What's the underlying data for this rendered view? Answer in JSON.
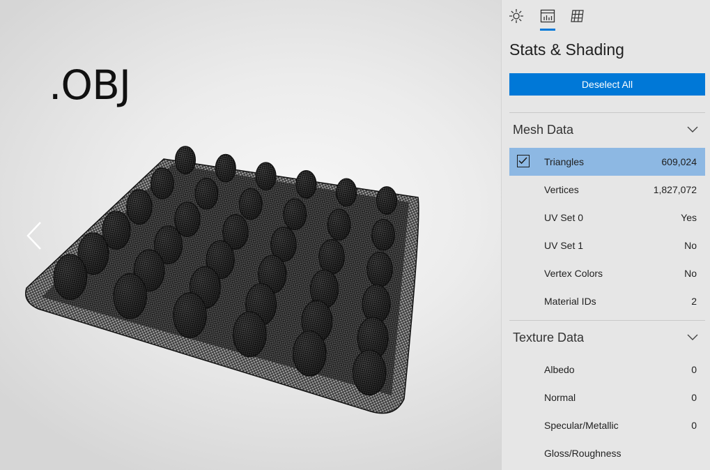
{
  "viewport": {
    "file_label": ".OBJ"
  },
  "panel": {
    "tabs": [
      "sun-icon",
      "stats-chart-icon",
      "grid-icon"
    ],
    "active_tab": 1,
    "title": "Stats & Shading",
    "deselect_label": "Deselect All",
    "mesh_section": {
      "label": "Mesh Data",
      "rows": [
        {
          "label": "Triangles",
          "value": "609,024",
          "checked": true
        },
        {
          "label": "Vertices",
          "value": "1,827,072"
        },
        {
          "label": "UV Set 0",
          "value": "Yes"
        },
        {
          "label": "UV Set 1",
          "value": "No"
        },
        {
          "label": "Vertex Colors",
          "value": "No"
        },
        {
          "label": "Material IDs",
          "value": "2"
        }
      ]
    },
    "texture_section": {
      "label": "Texture Data",
      "rows": [
        {
          "label": "Albedo",
          "value": "0"
        },
        {
          "label": "Normal",
          "value": "0"
        },
        {
          "label": "Specular/Metallic",
          "value": "0"
        },
        {
          "label": "Gloss/Roughness",
          "value": ""
        }
      ]
    }
  },
  "colors": {
    "accent": "#0078d7",
    "selected_row": "#8db8e3",
    "panel_bg": "#e6e6e6"
  }
}
